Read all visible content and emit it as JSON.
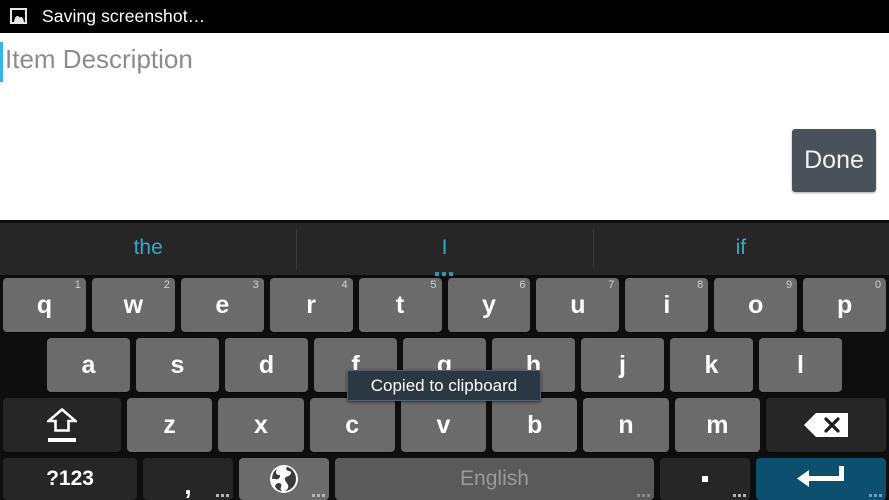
{
  "status_bar": {
    "icon": "image-icon",
    "text": "Saving screenshot…"
  },
  "content": {
    "field_placeholder": "Item Description",
    "field_value": "",
    "done_label": "Done"
  },
  "keyboard": {
    "suggestions": [
      {
        "label": "the",
        "has_dots": false
      },
      {
        "label": "I",
        "has_dots": true
      },
      {
        "label": "if",
        "has_dots": false
      }
    ],
    "row1": [
      {
        "label": "q",
        "hint": "1"
      },
      {
        "label": "w",
        "hint": "2"
      },
      {
        "label": "e",
        "hint": "3"
      },
      {
        "label": "r",
        "hint": "4"
      },
      {
        "label": "t",
        "hint": "5"
      },
      {
        "label": "y",
        "hint": "6"
      },
      {
        "label": "u",
        "hint": "7"
      },
      {
        "label": "i",
        "hint": "8"
      },
      {
        "label": "o",
        "hint": "9"
      },
      {
        "label": "p",
        "hint": "0"
      }
    ],
    "row2": [
      {
        "label": "a"
      },
      {
        "label": "s"
      },
      {
        "label": "d"
      },
      {
        "label": "f"
      },
      {
        "label": "g"
      },
      {
        "label": "h"
      },
      {
        "label": "j"
      },
      {
        "label": "k"
      },
      {
        "label": "l"
      }
    ],
    "row3_letters": [
      {
        "label": "z"
      },
      {
        "label": "x"
      },
      {
        "label": "c"
      },
      {
        "label": "v"
      },
      {
        "label": "b"
      },
      {
        "label": "n"
      },
      {
        "label": "m"
      }
    ],
    "shift_key": {
      "icon": "shift-icon",
      "label": ""
    },
    "backspace_key": {
      "icon": "backspace-icon",
      "label": ""
    },
    "row4": {
      "symbols_label": "?123",
      "comma_label": ",",
      "globe_icon": "globe-icon",
      "space_label": "English",
      "period_label": ".",
      "enter_icon": "enter-icon"
    }
  },
  "toast": {
    "message": "Copied to clipboard"
  },
  "colors": {
    "status_bar_bg": "#000000",
    "content_bg": "#ffffff",
    "caret": "#33b5e5",
    "placeholder_text": "#8c8c8c",
    "done_bg": "#4a5159",
    "keyboard_bg": "#0e0e0e",
    "key_bg": "#6b6b6b",
    "key_dark_bg": "#262626",
    "space_bg": "#5a5a5a",
    "enter_bg": "#0d4f6e",
    "suggestion_text": "#33a8cc",
    "toast_bg": "#2b3742"
  }
}
